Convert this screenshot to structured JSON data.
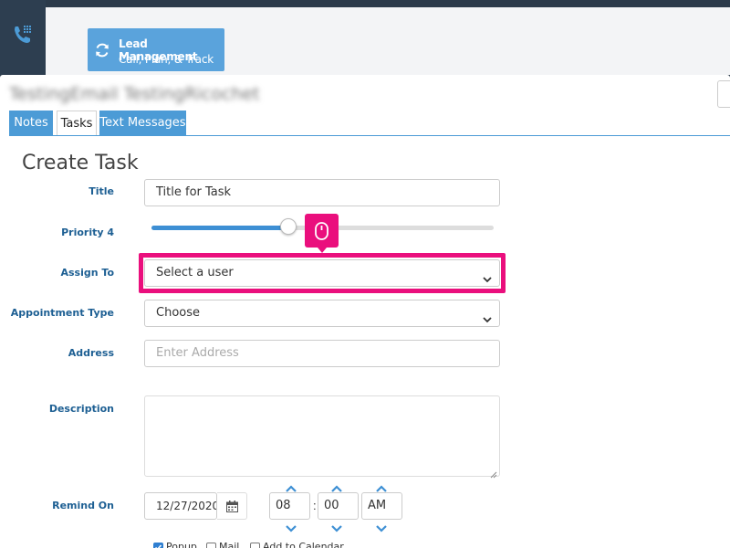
{
  "header": {
    "lead_card": {
      "title": "Lead Management",
      "subtitle": "Call, Plan, & Track"
    }
  },
  "contact": {
    "name": "TestingEmail TestingRicochet"
  },
  "tabs": [
    {
      "label": "Notes"
    },
    {
      "label": "Tasks",
      "active": true
    },
    {
      "label": "Text Messages"
    }
  ],
  "form": {
    "heading": "Create Task",
    "title_label": "Title",
    "title_value": "Title for Task",
    "priority_label": "Priority 4",
    "priority_value": 4,
    "priority_fraction": 0.4,
    "assign_label": "Assign To",
    "assign_value": "Select a user",
    "appointment_label": "Appointment Type",
    "appointment_value": "Choose",
    "address_label": "Address",
    "address_placeholder": "Enter Address",
    "description_label": "Description",
    "description_value": "",
    "remind_label": "Remind On",
    "remind_date": "12/27/2020",
    "remind_hour": "08",
    "remind_minute": "00",
    "remind_ampm": "AM",
    "time_separator": ":",
    "options": [
      {
        "label": "Popup",
        "checked": true
      },
      {
        "label": "Mail",
        "checked": false
      },
      {
        "label": "Add to Calendar",
        "checked": false
      }
    ]
  },
  "colors": {
    "accent": "#4c9bd6",
    "highlight": "#ea0f7d",
    "label": "#1d5f93"
  },
  "icons": {
    "sidebar": "phone-dialpad-icon",
    "lead_card": "refresh-icon",
    "click_marker": "mouse-icon",
    "date": "calendar-icon"
  }
}
